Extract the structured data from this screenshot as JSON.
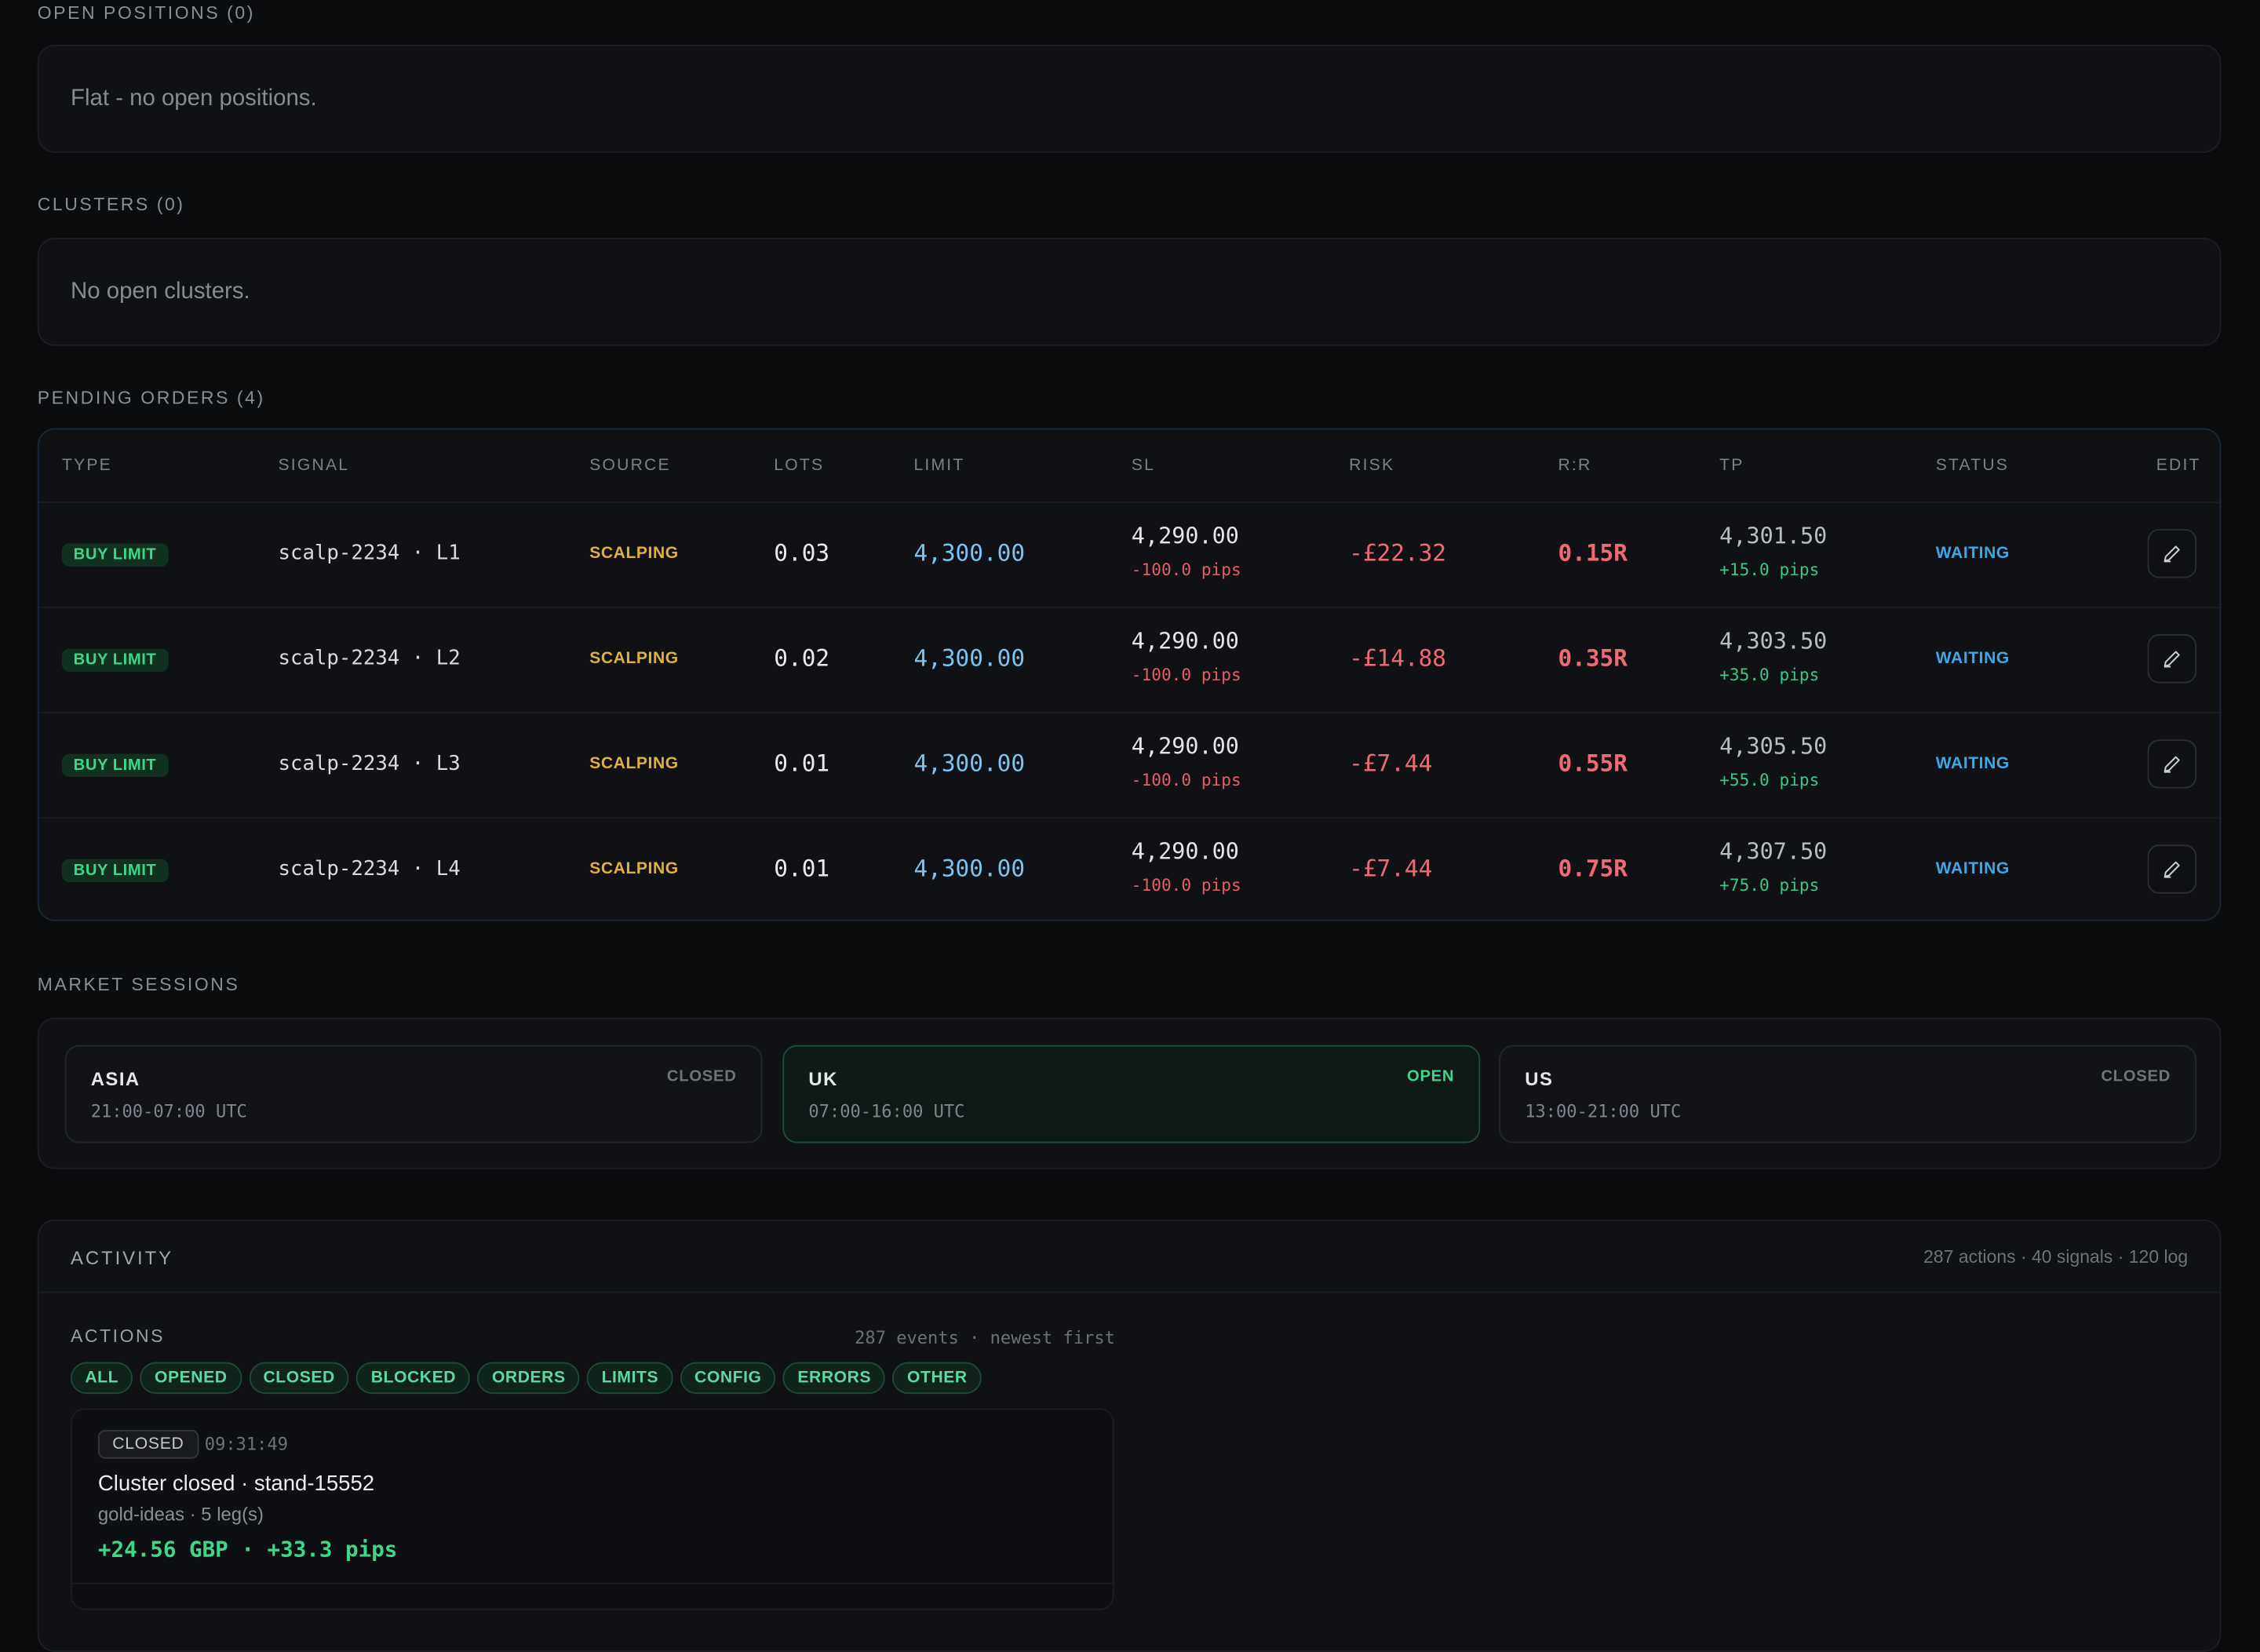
{
  "open_positions": {
    "label": "OPEN POSITIONS (0)",
    "empty_text": "Flat - no open positions."
  },
  "clusters": {
    "label": "CLUSTERS (0)",
    "empty_text": "No open clusters."
  },
  "pending_orders": {
    "label": "PENDING ORDERS (4)",
    "columns": [
      "TYPE",
      "SIGNAL",
      "SOURCE",
      "LOTS",
      "LIMIT",
      "SL",
      "RISK",
      "R:R",
      "TP",
      "STATUS",
      "EDIT"
    ],
    "rows": [
      {
        "type": "BUY LIMIT",
        "signal": "scalp-2234 · L1",
        "source": "SCALPING",
        "lots": "0.03",
        "limit": "4,300.00",
        "sl": "4,290.00",
        "sl_pips": "-100.0 pips",
        "risk": "-£22.32",
        "rr": "0.15R",
        "tp": "4,301.50",
        "tp_pips": "+15.0 pips",
        "status": "WAITING"
      },
      {
        "type": "BUY LIMIT",
        "signal": "scalp-2234 · L2",
        "source": "SCALPING",
        "lots": "0.02",
        "limit": "4,300.00",
        "sl": "4,290.00",
        "sl_pips": "-100.0 pips",
        "risk": "-£14.88",
        "rr": "0.35R",
        "tp": "4,303.50",
        "tp_pips": "+35.0 pips",
        "status": "WAITING"
      },
      {
        "type": "BUY LIMIT",
        "signal": "scalp-2234 · L3",
        "source": "SCALPING",
        "lots": "0.01",
        "limit": "4,300.00",
        "sl": "4,290.00",
        "sl_pips": "-100.0 pips",
        "risk": "-£7.44",
        "rr": "0.55R",
        "tp": "4,305.50",
        "tp_pips": "+55.0 pips",
        "status": "WAITING"
      },
      {
        "type": "BUY LIMIT",
        "signal": "scalp-2234 · L4",
        "source": "SCALPING",
        "lots": "0.01",
        "limit": "4,300.00",
        "sl": "4,290.00",
        "sl_pips": "-100.0 pips",
        "risk": "-£7.44",
        "rr": "0.75R",
        "tp": "4,307.50",
        "tp_pips": "+75.0 pips",
        "status": "WAITING"
      }
    ],
    "edit_icon": "pencil-icon"
  },
  "market_sessions": {
    "label": "MARKET SESSIONS",
    "sessions": [
      {
        "name": "ASIA",
        "hours": "21:00-07:00 UTC",
        "state": "CLOSED"
      },
      {
        "name": "UK",
        "hours": "07:00-16:00 UTC",
        "state": "OPEN"
      },
      {
        "name": "US",
        "hours": "13:00-21:00 UTC",
        "state": "CLOSED"
      }
    ]
  },
  "activity": {
    "title": "ACTIVITY",
    "summary": "287 actions · 40 signals · 120 log",
    "actions_label": "ACTIONS",
    "actions_meta": "287 events · newest first",
    "filters": [
      "ALL",
      "OPENED",
      "CLOSED",
      "BLOCKED",
      "ORDERS",
      "LIMITS",
      "CONFIG",
      "ERRORS",
      "OTHER"
    ],
    "events": [
      {
        "badge": "CLOSED",
        "time": "09:31:49",
        "title": "Cluster closed · stand-15552",
        "subtitle": "gold-ideas · 5 leg(s)",
        "result": "+24.56 GBP · +33.3 pips"
      }
    ]
  },
  "colors": {
    "background": "#0b0c0e",
    "profit": "#3fd68a",
    "loss": "#f06a76",
    "limit": "#7cc3f0",
    "source": "#e0b03a",
    "status": "#3ea7e8"
  }
}
